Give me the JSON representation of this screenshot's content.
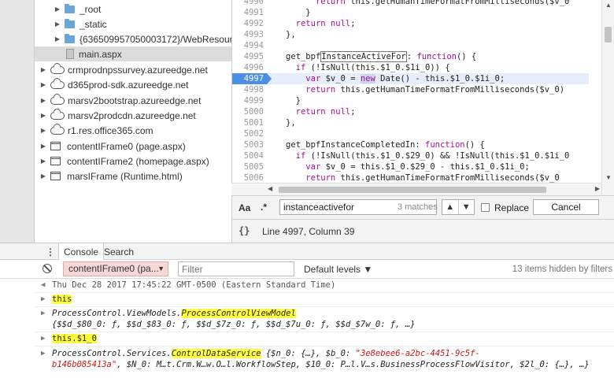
{
  "tree": {
    "items": [
      {
        "label": "_root",
        "kind": "folder"
      },
      {
        "label": "_static",
        "kind": "folder"
      },
      {
        "label": "{636509957050003172}/WebResource",
        "kind": "folder"
      },
      {
        "label": "main.aspx",
        "kind": "file"
      },
      {
        "label": "crmprodnpssurvey.azureedge.net",
        "kind": "cloud"
      },
      {
        "label": "d365prod-sdk.azureedge.net",
        "kind": "cloud"
      },
      {
        "label": "marsv2bootstrap.azureedge.net",
        "kind": "cloud"
      },
      {
        "label": "marsv2prodcdn.azureedge.net",
        "kind": "cloud"
      },
      {
        "label": "r1.res.office365.com",
        "kind": "cloud"
      },
      {
        "label": "contentIFrame0 (page.aspx)",
        "kind": "frame"
      },
      {
        "label": "contentIFrame2 (homepage.aspx)",
        "kind": "frame"
      },
      {
        "label": "marsIFrame (Runtime.html)",
        "kind": "frame"
      }
    ]
  },
  "editor": {
    "lines": [
      {
        "num": "4990",
        "indent": 6,
        "text": "return this.getHumanTimeFormatFromMilliseconds($v_0"
      },
      {
        "num": "4991",
        "indent": 4,
        "text": "}"
      },
      {
        "num": "4992",
        "indent": 2,
        "text": "return null;"
      },
      {
        "num": "4993",
        "indent": 0,
        "text": "},"
      },
      {
        "num": "4994",
        "indent": 0,
        "text": ""
      },
      {
        "num": "4995",
        "indent": 0,
        "text": "get_bpfInstanceActiveFor: function() {"
      },
      {
        "num": "4996",
        "indent": 2,
        "text": "if (!IsNull(this.$1_0.$1i_0)) {"
      },
      {
        "num": "4997",
        "indent": 4,
        "text": "var $v_0 = new Date() - this.$1_0.$1i_0;"
      },
      {
        "num": "4998",
        "indent": 4,
        "text": "return this.getHumanTimeFormatFromMilliseconds($v_0)"
      },
      {
        "num": "4999",
        "indent": 2,
        "text": "}"
      },
      {
        "num": "5000",
        "indent": 2,
        "text": "return null;"
      },
      {
        "num": "5001",
        "indent": 0,
        "text": "},"
      },
      {
        "num": "5002",
        "indent": 0,
        "text": ""
      },
      {
        "num": "5003",
        "indent": 0,
        "text": "get_bpfInstanceCompletedIn: function() {"
      },
      {
        "num": "5004",
        "indent": 2,
        "text": "if (!IsNull(this.$1_0.$29_0) && !IsNull(this.$1_0.$1i_0"
      },
      {
        "num": "5005",
        "indent": 4,
        "text": "var $v_0 = this.$1_0.$29_0 - this.$1_0.$1i_0;"
      },
      {
        "num": "5006",
        "indent": 4,
        "text": "return this.getHumanTimeFormatFromMilliseconds($v_0"
      },
      {
        "num": "5007",
        "indent": 2,
        "text": "}"
      }
    ],
    "current_line": "4997"
  },
  "search": {
    "case_label": "Aa",
    "regex_label": ".*",
    "query": "instanceactivefor",
    "matches": "3 matches",
    "prev": "▲",
    "next": "▼",
    "replace_label": "Replace",
    "cancel_label": "Cancel"
  },
  "status": {
    "braces": "{}",
    "position": "Line 4997, Column 39"
  },
  "drawer": {
    "menu": "⋮",
    "tabs": [
      "Console",
      "Search"
    ]
  },
  "console_toolbar": {
    "context": "contentIFrame0 (pa...",
    "filter_placeholder": "Filter",
    "levels": "Default levels ▼",
    "hidden": "13 items hidden by filters"
  },
  "console": {
    "date": "Thu Dec 28 2017 17:45:22 GMT-0500 (Eastern Standard Time)",
    "cmd1": "this",
    "res1_prefix": "ProcessControl.ViewModels.",
    "res1_hl": "ProcessControlViewModel",
    "res1_props": "{$$d_$80_0: ƒ, $$d_$83_0: ƒ, $$d_$7z_0: ƒ, $$d_$7u_0: ƒ, $$d_$7w_0: ƒ, …}",
    "cmd2": "this.$1_0",
    "res2_prefix": "ProcessControl.Services.",
    "res2_hl": "ControlDataService",
    "res2_props": "{$n_0: {…}, $b_0: ",
    "res2_str": "\"3e8ebee6-a2bc-4451-9c5f-",
    "res2_line2_str": "b146b085413a\"",
    "res2_line2": ", $N_0: M…t.Crm.W…w.O…l.WorkflowStep, $10_0: P…l.V…s.BusinessProcessFlowVisitor, $2l_0: {…}, …}"
  }
}
